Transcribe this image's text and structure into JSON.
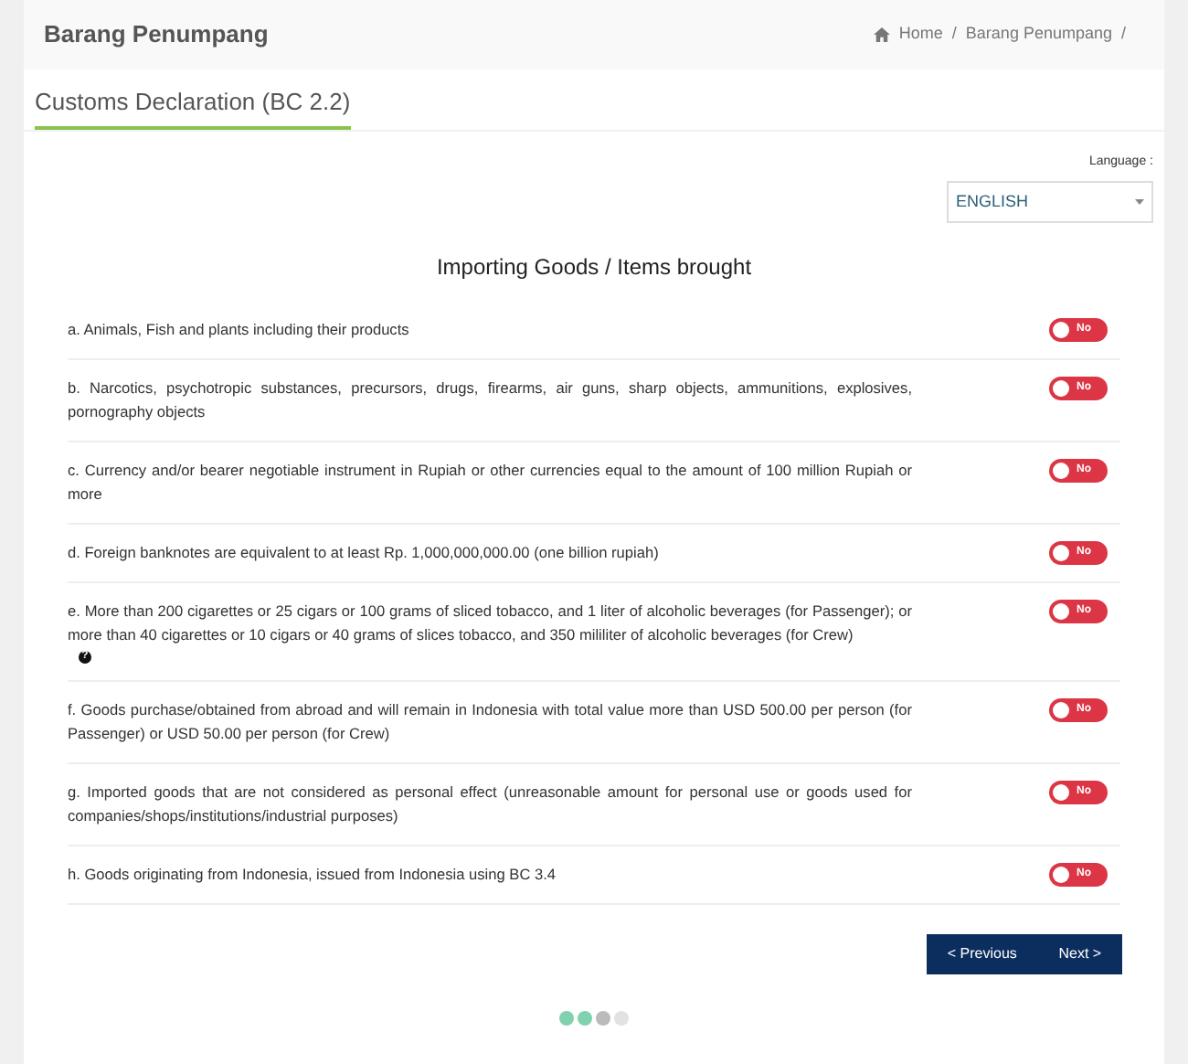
{
  "header": {
    "title": "Barang Penumpang",
    "breadcrumb": [
      {
        "label": "Home",
        "separator": "/"
      },
      {
        "label": "Barang Penumpang",
        "separator": "/"
      }
    ]
  },
  "tab": {
    "label": "Customs Declaration (BC 2.2)",
    "selected": true
  },
  "language": {
    "label": "Language :",
    "value": "ENGLISH"
  },
  "section_title": "Importing Goods / Items brought",
  "questions": [
    {
      "text": "a. Animals, Fish and plants including their products",
      "on": false,
      "toggle_label": "No"
    },
    {
      "text": "b. Narcotics, psychotropic substances, precursors, drugs, firearms, air guns, sharp objects, ammunitions, explosives, pornography objects",
      "on": false,
      "toggle_label": "No"
    },
    {
      "text": "c. Currency and/or bearer negotiable instrument in Rupiah or other currencies equal to the amount of 100 million Rupiah or more",
      "on": false,
      "toggle_label": "No"
    },
    {
      "text": "d. Foreign banknotes are equivalent to at least Rp. 1,000,000,000.00 (one billion rupiah)",
      "on": false,
      "toggle_label": "No"
    },
    {
      "text": "e. More than 200 cigarettes or 25 cigars or 100 grams of sliced tobacco, and 1 liter of alcoholic beverages (for Passenger); or more than 40 cigarettes or 10 cigars or 40 grams of slices tobacco, and 350 mililiter of alcoholic beverages (for Crew)",
      "help_icon": "?",
      "on": false,
      "toggle_label": "No"
    },
    {
      "text": "f. Goods purchase/obtained from abroad and will remain in Indonesia with total value more than USD 500.00 per person (for Passenger) or USD 50.00 per person (for Crew)",
      "on": false,
      "toggle_label": "No"
    },
    {
      "text": "g. Imported goods that are not considered as personal effect (unreasonable amount for personal use or goods used for companies/shops/institutions/industrial purposes)",
      "on": false,
      "toggle_label": "No"
    },
    {
      "text": "h. Goods originating from Indonesia, issued from Indonesia using BC 3.4",
      "on": false,
      "toggle_label": "No"
    }
  ],
  "buttons": [
    "< Previous",
    "Next >"
  ],
  "steps": [
    {
      "color": "#7fd1b0"
    },
    {
      "color": "#7fd1b0"
    },
    {
      "color": "#bbbbbb"
    },
    {
      "color": "#e2e2e2"
    }
  ]
}
